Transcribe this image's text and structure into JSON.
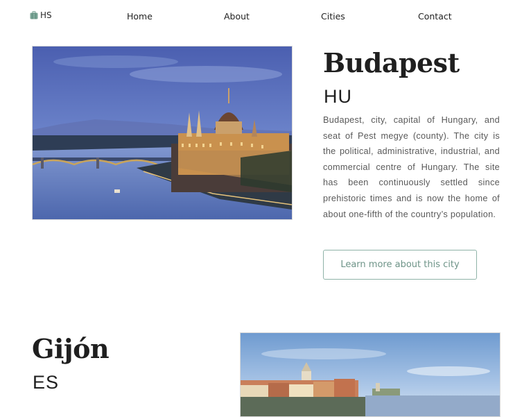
{
  "nav": {
    "logo_text": "HS",
    "links": [
      "Home",
      "About",
      "Cities",
      "Contact"
    ]
  },
  "cities": [
    {
      "name": "Budapest",
      "code": "HU",
      "description": "Budapest, city, capital of Hungary, and seat of Pest megye (county). The city is the political, administrative, industrial, and commercial centre of Hungary. The site has been continuously settled since prehistoric times and is now the home of about one-fifth of the country’s population.",
      "button_label": "Learn more about this city"
    },
    {
      "name": "Gijón",
      "code": "ES"
    }
  ],
  "colors": {
    "accent": "#6e9488",
    "logo_icon": "#7aa596"
  },
  "icons": {
    "logo": "suitcase-icon"
  }
}
